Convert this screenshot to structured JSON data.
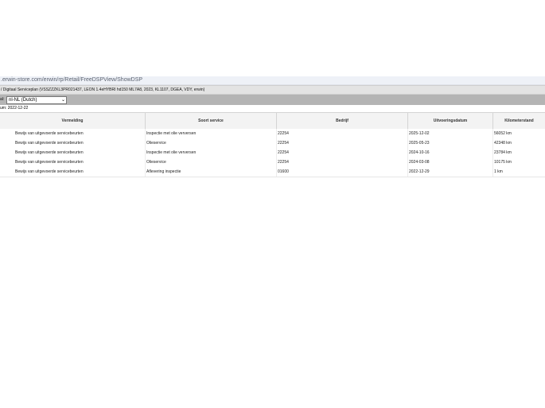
{
  "browser": {
    "url": ".erwin-store.com/erwin/rp/Retail/FreeDSPView/ShowDSP"
  },
  "page": {
    "header": "/ Digitaal Serviceplan (VSSZZZKL3PR021437, LEON 1.4eHYBRI hd150 ML7A8, 2023, KL1107, DGEA, VDY, erwin)",
    "language_label": "al:",
    "language_value": "nl-NL (Dutch)",
    "date_text": "um: 2022-12-22"
  },
  "table": {
    "headers": [
      "Vermelding",
      "Soort service",
      "Bedrijf",
      "Uitvoeringsdatum",
      "Kilometerstand"
    ],
    "rows": [
      [
        "Bewijs van uitgevoerde servicebeurten",
        "Inspectie met olie verversen",
        "22254",
        "2025-12-02",
        "56052 km"
      ],
      [
        "Bewijs van uitgevoerde servicebeurten",
        "Olieservice",
        "22254",
        "2025-05-23",
        "42348 km"
      ],
      [
        "Bewijs van uitgevoerde servicebeurten",
        "Inspectie met olie verversen",
        "22254",
        "2024-10-16",
        "23784 km"
      ],
      [
        "Bewijs van uitgevoerde servicebeurten",
        "Olieservice",
        "22254",
        "2024-03-08",
        "10175 km"
      ],
      [
        "Bewijs van uitgevoerde servicebeurten",
        "Aflevering inspectie",
        "01600",
        "2022-12-29",
        "1 km"
      ]
    ]
  }
}
